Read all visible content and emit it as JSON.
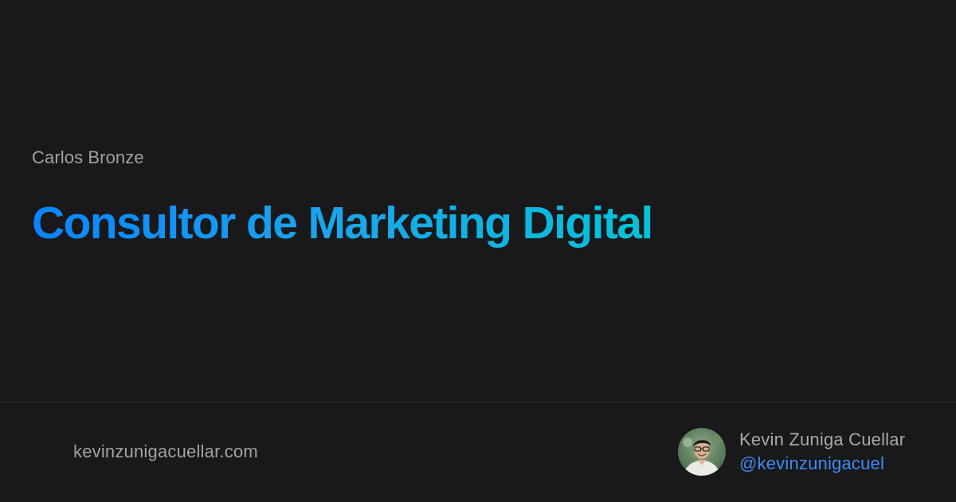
{
  "card": {
    "eyebrow": "Carlos Bronze",
    "title": "Consultor de Marketing Digital",
    "title_gradient": [
      "#0a84ff",
      "#06c2d8"
    ],
    "background": "#19191b"
  },
  "footer": {
    "site": "kevinzunigacuellar.com",
    "author": {
      "name": "Kevin Zuniga Cuellar",
      "handle": "@kevinzunigacuel",
      "handle_color": "#3d8bf5",
      "avatar_icon": "user-photo"
    }
  }
}
